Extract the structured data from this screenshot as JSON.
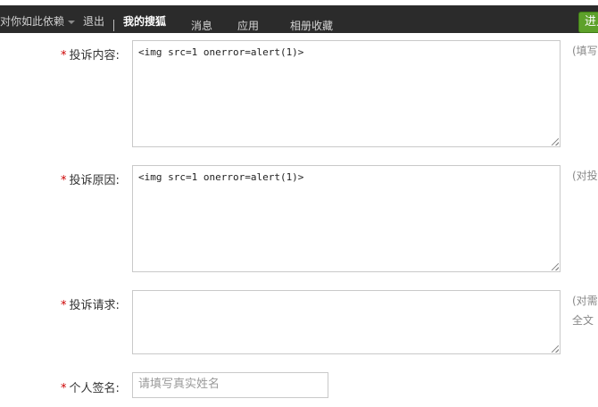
{
  "topbar": {
    "user_name": "对你如此依赖",
    "logout": "退出",
    "my_sohu": "我的搜狐",
    "messages": "消息",
    "apps": "应用",
    "album": "相册收藏",
    "enter_button": "进入"
  },
  "form": {
    "content": {
      "required_mark": "*",
      "label": "投诉内容:",
      "value": "<img src=1 onerror=alert(1)>",
      "hint": "(填写"
    },
    "reason": {
      "required_mark": "*",
      "label": "投诉原因:",
      "value": "<img src=1 onerror=alert(1)>",
      "hint": "(对投"
    },
    "request": {
      "required_mark": "*",
      "label": "投诉请求:",
      "value": "",
      "hint_line1": "(对需",
      "hint_line2": "全文"
    },
    "signature": {
      "required_mark": "*",
      "label": "个人签名:",
      "placeholder": "请填写真实姓名",
      "value": ""
    }
  },
  "colors": {
    "topbar_bg": "#2b2b2b",
    "enter_button_bg": "#5da12a",
    "required_mark": "#cc0000",
    "field_border": "#c9c9c9"
  }
}
